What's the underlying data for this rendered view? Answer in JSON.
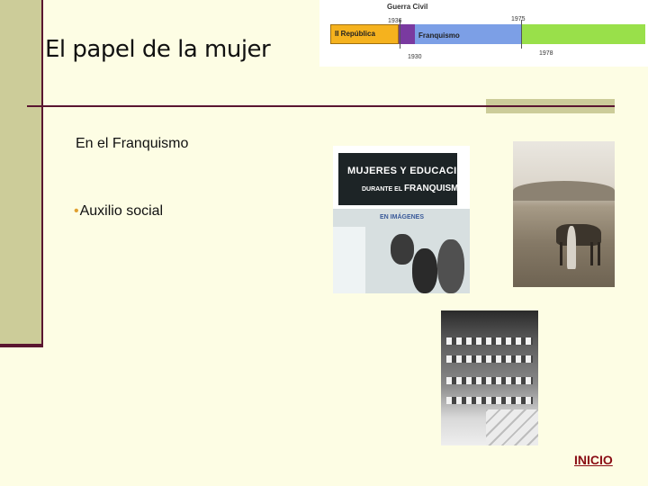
{
  "slide": {
    "title": "El papel de la mujer",
    "subtitle": "En el Franquismo",
    "bullet_marker": "•",
    "bullet": "Auxilio social",
    "home_link": "INICIO"
  },
  "timeline": {
    "header": "Guerra Civil",
    "year_start_war": "1936",
    "year_end_franco": "1975",
    "year_republic": "1930",
    "year_democracy": "1978",
    "segments": {
      "republic": "II República",
      "franquismo": "Franquismo"
    }
  },
  "images": {
    "book_title_1": "MUJERES Y EDUCACIÓN",
    "book_title_2": "DURANTE EL",
    "book_title_3": "FRANQUISMO",
    "book_subtitle": "EN IMÁGENES"
  },
  "colors": {
    "background": "#fdfde4",
    "accent_bar": "#cccc99",
    "rule": "#5a1530",
    "link": "#8a0d14",
    "bullet": "#e0a030"
  }
}
